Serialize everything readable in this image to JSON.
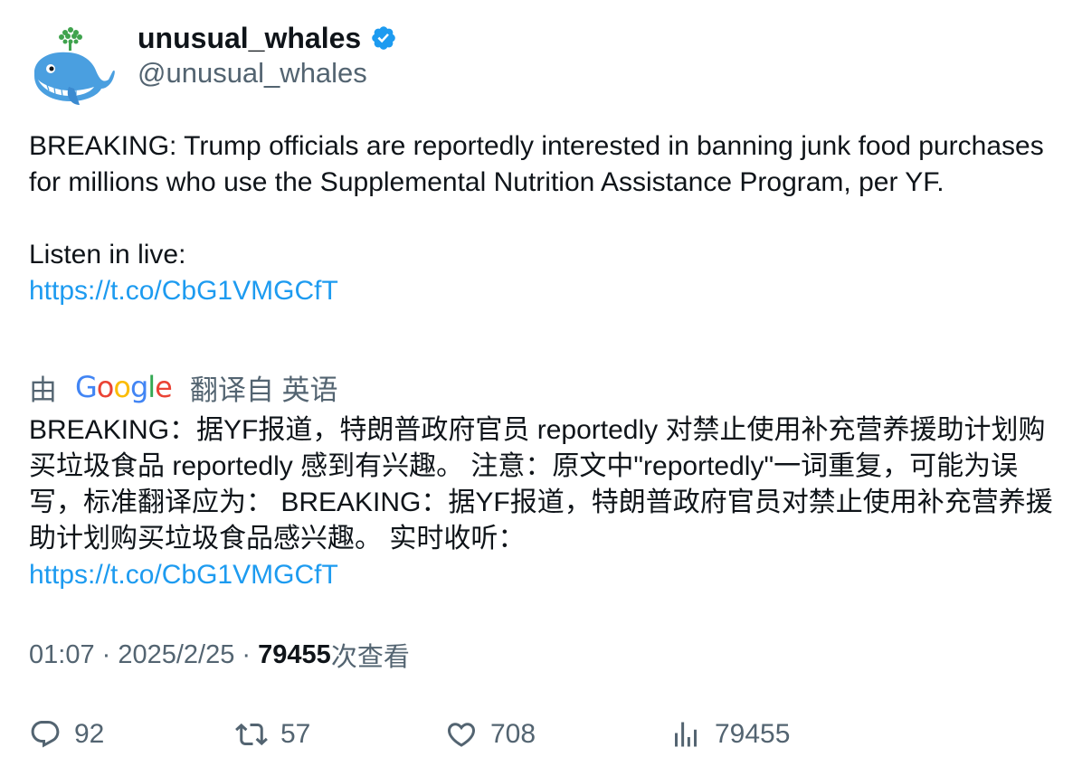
{
  "author": {
    "display_name": "unusual_whales",
    "handle": "@unusual_whales",
    "verified": true,
    "avatar_icon": "whale-avatar-icon",
    "verified_color": "#1d9bf0"
  },
  "tweet": {
    "paragraph1": "BREAKING: Trump officials are reportedly interested in banning junk food purchases for millions who use the Supplemental Nutrition Assistance Program, per YF.",
    "paragraph2": "Listen in live:",
    "link": "https://t.co/CbG1VMGCfT"
  },
  "translation": {
    "prefix": "由",
    "provider": "Google",
    "suffix": "翻译自 英语",
    "text": "BREAKING：据YF报道，特朗普政府官员 reportedly 对禁止使用补充营养援助计划购买垃圾食品 reportedly 感到有兴趣。 注意：原文中\"reportedly\"一词重复，可能为误写，标准翻译应为： BREAKING：据YF报道，特朗普政府官员对禁止使用补充营养援助计划购买垃圾食品感兴趣。 实时收听：",
    "link": "https://t.co/CbG1VMGCfT"
  },
  "meta": {
    "time": "01:07",
    "separator1": " · ",
    "date": "2025/2/25",
    "separator2": " · ",
    "views_count": "79455",
    "views_label": "次查看"
  },
  "actions": {
    "replies": "92",
    "retweets": "57",
    "likes": "708",
    "views": "79455"
  },
  "colors": {
    "link": "#1d9bf0",
    "secondary_text": "#536471",
    "primary_text": "#0f1419"
  }
}
